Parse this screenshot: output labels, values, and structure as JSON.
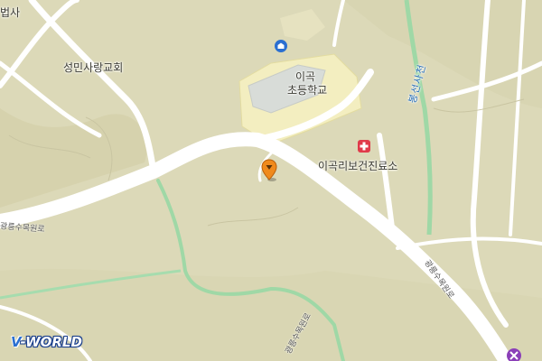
{
  "map": {
    "places": {
      "temple_partial": "법사",
      "church": "성민사랑교회",
      "school_line1": "이곡",
      "school_line2": "초등학교",
      "clinic": "이곡리보건진료소",
      "stream": "봉선사천"
    },
    "roads": {
      "road_left": "광릉수목원로",
      "road_right": "광릉수목원로",
      "road_bottom": "광릉수목원로"
    },
    "logo": {
      "v": "V",
      "rest": "-WORLD"
    },
    "colors": {
      "land": "#dcd9b8",
      "road": "#ffffff",
      "school_area": "#f3eec0",
      "stream": "#9fd8a6",
      "marker": "#f08a1c",
      "clinic": "#e03a4a"
    }
  }
}
